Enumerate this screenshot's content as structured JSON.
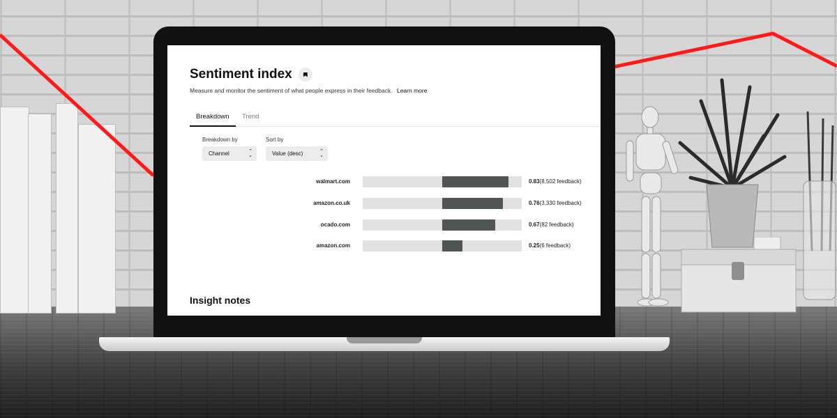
{
  "page": {
    "title": "Sentiment index",
    "description": "Measure and monitor the sentiment of what people express in their feedback.",
    "learn_more": "Learn more"
  },
  "tabs": [
    {
      "label": "Breakdown",
      "active": true
    },
    {
      "label": "Trend",
      "active": false
    }
  ],
  "controls": {
    "breakdown_by": {
      "label": "Breakdown by",
      "value": "Channel"
    },
    "sort_by": {
      "label": "Sort by",
      "value": "Value (desc)"
    }
  },
  "breakdown": {
    "scale_min": -1,
    "scale_max": 1,
    "rows": [
      {
        "channel": "walmart.com",
        "score": 0.83,
        "score_text": "0.83",
        "feedback_text": "(8,502 feedback)"
      },
      {
        "channel": "amazon.co.uk",
        "score": 0.76,
        "score_text": "0.76",
        "feedback_text": "(3,330 feedback)"
      },
      {
        "channel": "ocado.com",
        "score": 0.67,
        "score_text": "0.67",
        "feedback_text": "(82 feedback)"
      },
      {
        "channel": "amazon.com",
        "score": 0.25,
        "score_text": "0.25",
        "feedback_text": "(6 feedback)"
      }
    ]
  },
  "insight_notes": {
    "heading": "Insight notes"
  },
  "colors": {
    "bar_fill": "#4f5550",
    "bar_track": "#e1e1e1",
    "trend_line": "#ff1a1a"
  },
  "icons": {
    "bookmark": "bookmark-icon",
    "select_arrows": "up-down-chevron-icon"
  }
}
